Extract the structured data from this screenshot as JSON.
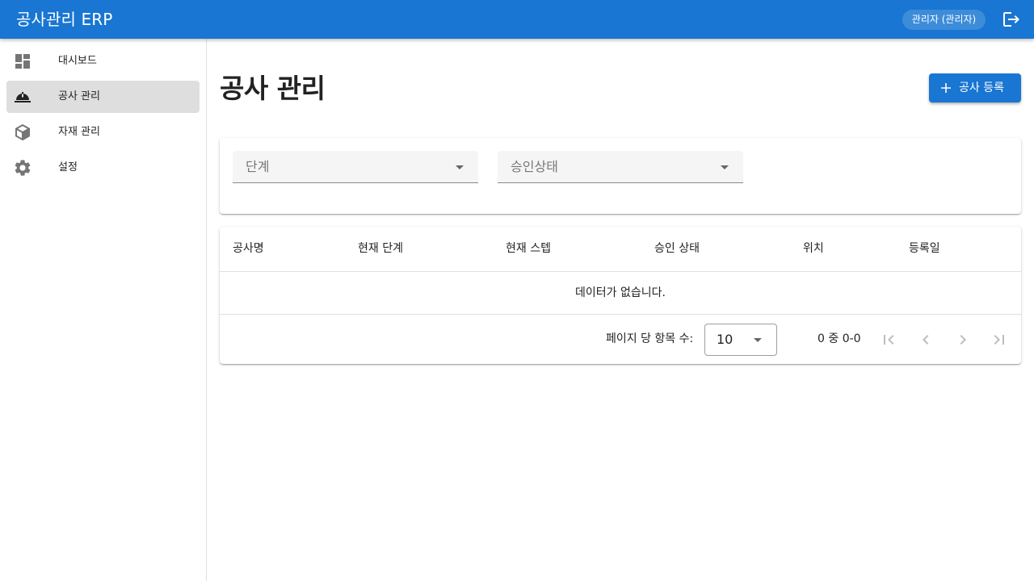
{
  "app": {
    "title": "공사관리 ERP",
    "user_chip": "관리자 (관리자)"
  },
  "icons": {
    "logout": "logout-icon",
    "dashboard": "dashboard-icon",
    "construction": "hard-hat-icon",
    "materials": "box-icon",
    "settings": "gear-icon",
    "add": "plus-icon"
  },
  "sidebar": {
    "items": [
      {
        "label": "대시보드",
        "active": false
      },
      {
        "label": "공사 관리",
        "active": true
      },
      {
        "label": "자재 관리",
        "active": false
      },
      {
        "label": "설정",
        "active": false
      }
    ]
  },
  "page": {
    "title": "공사 관리",
    "add_button": "공사 등록"
  },
  "filters": {
    "stage_placeholder": "단계",
    "approval_placeholder": "승인상태"
  },
  "table": {
    "columns": [
      "공사명",
      "현재 단계",
      "현재 스텝",
      "승인 상태",
      "위치",
      "등록일"
    ],
    "empty_message": "데이터가 없습니다.",
    "rows": []
  },
  "pagination": {
    "rows_per_page_label": "페이지 당 항목 수:",
    "rows_per_page": "10",
    "range_text": "0 중 0-0"
  },
  "colors": {
    "primary": "#1976d2",
    "active_nav": "#dedede",
    "field_bg": "#f5f5f5"
  }
}
